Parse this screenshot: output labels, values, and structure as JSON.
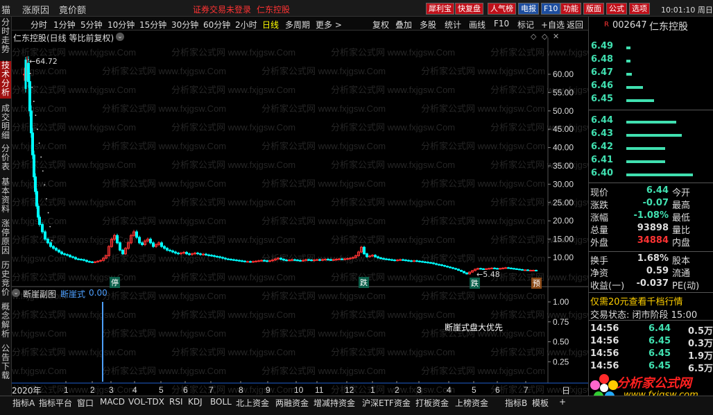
{
  "topbar": {
    "menu": [
      "猫",
      "涨原因",
      "竟价额"
    ],
    "notice": "证券交易未登录",
    "stock_name": "仁东控股",
    "buttons": [
      "犀利宝",
      "快复盘",
      "人气榜",
      "电报",
      "F10",
      "功能",
      "版面",
      "公式",
      "选项"
    ],
    "time": "10:01:10 周日"
  },
  "left_tabs": [
    "分时走势",
    "技术分析",
    "成交明细",
    "分价表",
    "基本资料",
    "涨停原因",
    "历史竞价",
    "概念解析",
    "公告下载"
  ],
  "period_bar": {
    "periods": [
      "分时",
      "1分钟",
      "5分钟",
      "10分钟",
      "15分钟",
      "30分钟",
      "60分钟",
      "2小时",
      "日线",
      "多周期",
      "更多 >"
    ],
    "active": "日线",
    "tools": [
      "复权",
      "叠加",
      "多股",
      "统计",
      "画线",
      "F10",
      "标记",
      "+自选",
      "返回"
    ]
  },
  "main_chart": {
    "title": "仁东控股(日线 等比前复权)",
    "high_label": "64.72",
    "low_label": "5.48",
    "y_ticks": [
      "60.00",
      "55.00",
      "50.00",
      "45.00",
      "40.00",
      "35.00",
      "30.00",
      "25.00",
      "20.00",
      "15.00",
      "10.00"
    ],
    "markers": [
      "停",
      "跌",
      "跌",
      "预"
    ],
    "watermark": "分析家公式网 www.fxjgsw.Com"
  },
  "sub_chart": {
    "title": "断崖副图",
    "indicator_label": "断崖式",
    "indicator_value": "0.00",
    "y_ticks": [
      "1.00",
      "0.75",
      "0.50",
      "0.25"
    ],
    "annotation": "断崖式盘大优先"
  },
  "x_axis": {
    "year": "2020年",
    "months": [
      "1",
      "2",
      "3",
      "4",
      "5",
      "6",
      "7",
      "8",
      "9",
      "10",
      "11",
      "12",
      "1",
      "2",
      "3",
      "4",
      "5",
      "6",
      "7"
    ],
    "end": "日"
  },
  "quote": {
    "badge": "R",
    "code": "002647",
    "name": "仁东控股",
    "asks": [
      {
        "price": "6.49",
        "vol": 0.04
      },
      {
        "price": "6.48",
        "vol": 0.04
      },
      {
        "price": "6.47",
        "vol": 0.05
      },
      {
        "price": "6.46",
        "vol": 0.15
      },
      {
        "price": "6.45",
        "vol": 0.25
      }
    ],
    "bids": [
      {
        "price": "6.44",
        "vol": 0.45
      },
      {
        "price": "6.43",
        "vol": 0.5
      },
      {
        "price": "6.42",
        "vol": 0.35
      },
      {
        "price": "6.41",
        "vol": 0.35
      },
      {
        "price": "6.40",
        "vol": 0.6
      }
    ],
    "stats": [
      {
        "l1": "现价",
        "v1": "6.44",
        "l2": "今开"
      },
      {
        "l1": "涨跌",
        "v1": "-0.07",
        "l2": "最高"
      },
      {
        "l1": "涨幅",
        "v1": "-1.08%",
        "l2": "最低"
      },
      {
        "l1": "总量",
        "v1": "93898",
        "l2": "量比"
      },
      {
        "l1": "外盘",
        "v1": "34884",
        "l2": "内盘"
      }
    ],
    "stats2": [
      {
        "l1": "换手",
        "v1": "1.68%",
        "l2": "股本"
      },
      {
        "l1": "净资",
        "v1": "0.59",
        "l2": "流通"
      },
      {
        "l1": "收益(一)",
        "v1": "-0.037",
        "l2": "PE(动)"
      }
    ],
    "promo": "仅需20元查看千档行情",
    "trade_status": "交易状态: 闭市阶段 15:00",
    "ticks": [
      {
        "time": "14:56",
        "price": "6.44",
        "vol": "0.5万"
      },
      {
        "time": "14:56",
        "price": "6.45",
        "vol": "0.3万"
      },
      {
        "time": "14:56",
        "price": "6.45",
        "vol": "1.9万"
      },
      {
        "time": "14:56",
        "price": "6.45",
        "vol": "6.5万"
      }
    ]
  },
  "logo": {
    "text": "分析家公式网",
    "url": "www.fxjgsw.com"
  },
  "bottom_tabs": [
    "指标A",
    "指标平台",
    "窗口",
    "MACD",
    "VOL-TDX",
    "RSI",
    "KDJ",
    "BOLL",
    "北上资金",
    "两融资金",
    "增减持资金",
    "沪深ETF资金",
    "打板资金",
    "上榜资金",
    "指标B",
    "模板",
    "+"
  ],
  "colors": {
    "up": "#ff3333",
    "down": "#00ffff",
    "accent": "#ffff00",
    "ask_bar": "#40e0b0",
    "panel": "#1a1a1a"
  }
}
